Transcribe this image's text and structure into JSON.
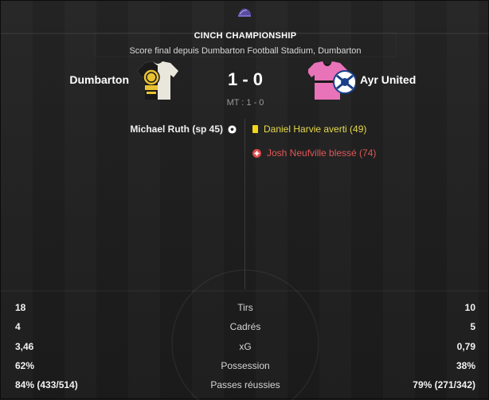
{
  "header": {
    "competition": "CINCH CHAMPIONSHIP",
    "subtitle": "Score final depuis Dumbarton Football Stadium, Dumbarton"
  },
  "match": {
    "home_team": "Dumbarton",
    "away_team": "Ayr United",
    "score": "1 - 0",
    "half_time": "MT : 1 - 0"
  },
  "events": {
    "home": [
      {
        "text": "Michael Ruth (sp 45)",
        "icon": "football-icon"
      }
    ],
    "away": [
      {
        "text": "Daniel Harvie averti (49)",
        "icon": "yellow-card-icon"
      },
      {
        "text": "Josh Neufville blessé (74)",
        "icon": "injury-icon"
      }
    ]
  },
  "stats": [
    {
      "home": "18",
      "label": "Tirs",
      "away": "10"
    },
    {
      "home": "4",
      "label": "Cadrés",
      "away": "5"
    },
    {
      "home": "3,46",
      "label": "xG",
      "away": "0,79"
    },
    {
      "home": "62%",
      "label": "Possession",
      "away": "38%"
    },
    {
      "home": "84% (433/514)",
      "label": "Passes réussies",
      "away": "79% (271/342)"
    }
  ],
  "colors": {
    "yellow_event": "#e6d94a",
    "red_event": "#e05656",
    "home_kit_primary": "#1a1a1a",
    "home_kit_secondary": "#e8c233",
    "away_kit_primary": "#e873b8",
    "away_kit_secondary": "#1a1a1a"
  }
}
